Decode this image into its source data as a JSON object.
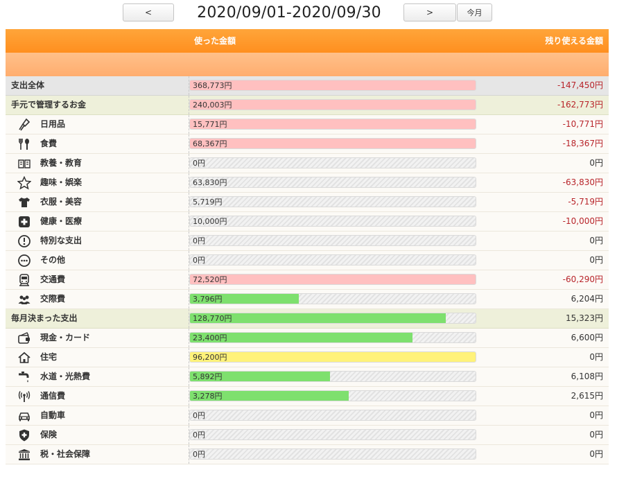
{
  "nav": {
    "prev_label": "<",
    "next_label": ">",
    "today_label": "今月",
    "period": "2020/09/01-2020/09/30"
  },
  "header": {
    "spent": "使った金額",
    "remaining": "残り使える金額"
  },
  "colors": {
    "header_orange": "#ff8f1f",
    "over_budget": "#ffc0c0",
    "within_budget": "#7ee06e",
    "exact_budget": "#fff27a",
    "negative_text": "#b8242a"
  },
  "rows": [
    {
      "type": "total",
      "label": "支出全体",
      "spent": "368,773円",
      "remaining": "-147,450円",
      "fill": 1.0,
      "status": "over",
      "negative": true
    },
    {
      "type": "group",
      "label": "手元で管理するお金",
      "spent": "240,003円",
      "remaining": "-162,773円",
      "fill": 1.0,
      "status": "over",
      "negative": true
    },
    {
      "type": "item",
      "label": "日用品",
      "icon": "brush-icon",
      "spent": "15,771円",
      "remaining": "-10,771円",
      "fill": 1.0,
      "status": "over",
      "negative": true
    },
    {
      "type": "item",
      "label": "食費",
      "icon": "fork-spoon-icon",
      "spent": "68,367円",
      "remaining": "-18,367円",
      "fill": 1.0,
      "status": "over",
      "negative": true
    },
    {
      "type": "item",
      "label": "教養・教育",
      "icon": "book-icon",
      "spent": "0円",
      "remaining": "0円",
      "fill": 0,
      "status": "none",
      "negative": false
    },
    {
      "type": "item",
      "label": "趣味・娯楽",
      "icon": "star-icon",
      "spent": "63,830円",
      "remaining": "-63,830円",
      "fill": 0,
      "status": "none",
      "negative": true
    },
    {
      "type": "item",
      "label": "衣服・美容",
      "icon": "shirt-icon",
      "spent": "5,719円",
      "remaining": "-5,719円",
      "fill": 0,
      "status": "none",
      "negative": true
    },
    {
      "type": "item",
      "label": "健康・医療",
      "icon": "medical-cross-icon",
      "spent": "10,000円",
      "remaining": "-10,000円",
      "fill": 0,
      "status": "none",
      "negative": true
    },
    {
      "type": "item",
      "label": "特別な支出",
      "icon": "exclamation-icon",
      "spent": "0円",
      "remaining": "0円",
      "fill": 0,
      "status": "none",
      "negative": false
    },
    {
      "type": "item",
      "label": "その他",
      "icon": "more-icon",
      "spent": "0円",
      "remaining": "0円",
      "fill": 0,
      "status": "none",
      "negative": false
    },
    {
      "type": "item",
      "label": "交通費",
      "icon": "train-icon",
      "spent": "72,520円",
      "remaining": "-60,290円",
      "fill": 1.0,
      "status": "over",
      "negative": true
    },
    {
      "type": "item",
      "label": "交際費",
      "icon": "people-icon",
      "spent": "3,796円",
      "remaining": "6,204円",
      "fill": 0.38,
      "status": "ok",
      "negative": false
    },
    {
      "type": "group",
      "label": "毎月決まった支出",
      "spent": "128,770円",
      "remaining": "15,323円",
      "fill": 0.895,
      "status": "ok",
      "negative": false
    },
    {
      "type": "item",
      "label": "現金・カード",
      "icon": "wallet-icon",
      "spent": "23,400円",
      "remaining": "6,600円",
      "fill": 0.78,
      "status": "ok",
      "negative": false
    },
    {
      "type": "item",
      "label": "住宅",
      "icon": "house-icon",
      "spent": "96,200円",
      "remaining": "0円",
      "fill": 1.0,
      "status": "exact",
      "negative": false
    },
    {
      "type": "item",
      "label": "水道・光熱費",
      "icon": "faucet-icon",
      "spent": "5,892円",
      "remaining": "6,108円",
      "fill": 0.49,
      "status": "ok",
      "negative": false
    },
    {
      "type": "item",
      "label": "通信費",
      "icon": "antenna-icon",
      "spent": "3,278円",
      "remaining": "2,615円",
      "fill": 0.555,
      "status": "ok",
      "negative": false
    },
    {
      "type": "item",
      "label": "自動車",
      "icon": "car-icon",
      "spent": "0円",
      "remaining": "0円",
      "fill": 0,
      "status": "none",
      "negative": false
    },
    {
      "type": "item",
      "label": "保険",
      "icon": "shield-plus-icon",
      "spent": "0円",
      "remaining": "0円",
      "fill": 0,
      "status": "none",
      "negative": false
    },
    {
      "type": "item",
      "label": "税・社会保障",
      "icon": "building-icon",
      "spent": "0円",
      "remaining": "0円",
      "fill": 0,
      "status": "none",
      "negative": false
    }
  ]
}
